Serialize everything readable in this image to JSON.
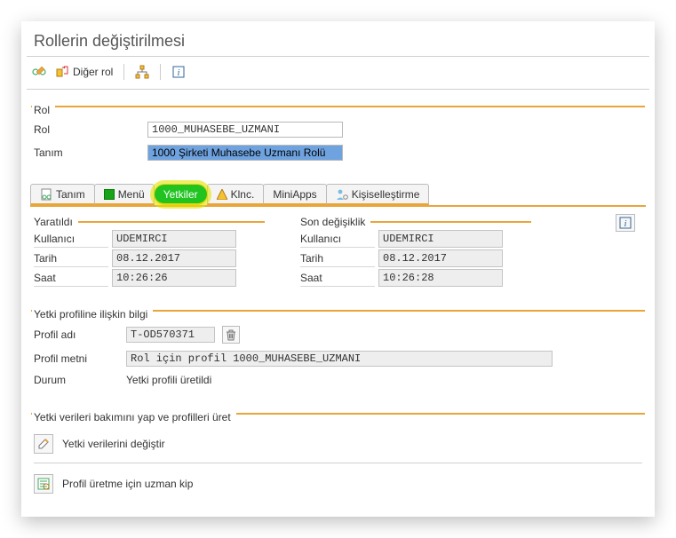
{
  "header": {
    "title": "Rollerin değiştirilmesi",
    "toolbar": {
      "other_role_label": "Diğer rol"
    }
  },
  "role_group": {
    "title": "Rol",
    "fields": {
      "role_label": "Rol",
      "role_value": "1000_MUHASEBE_UZMANI",
      "desc_label": "Tanım",
      "desc_value": "1000 Şirketi Muhasebe Uzmanı Rolü"
    }
  },
  "tabs": [
    {
      "label": "Tanım"
    },
    {
      "label": "Menü"
    },
    {
      "label": "Yetkiler"
    },
    {
      "label": "Klnc."
    },
    {
      "label": "MiniApps"
    },
    {
      "label": "Kişiselleştirme"
    }
  ],
  "created": {
    "title": "Yaratıldı",
    "user_label": "Kullanıcı",
    "user_value": "UDEMIRCI",
    "date_label": "Tarih",
    "date_value": "08.12.2017",
    "time_label": "Saat",
    "time_value": "10:26:26"
  },
  "changed": {
    "title": "Son değişiklik",
    "user_label": "Kullanıcı",
    "user_value": "UDEMIRCI",
    "date_label": "Tarih",
    "date_value": "08.12.2017",
    "time_label": "Saat",
    "time_value": "10:26:28"
  },
  "profile": {
    "title": "Yetki profiline ilişkin bilgi",
    "name_label": "Profil adı",
    "name_value": "T-OD570371",
    "text_label": "Profil metni",
    "text_value": "Rol için profil 1000_MUHASEBE_UZMANI",
    "status_label": "Durum",
    "status_value": "Yetki profili üretildi"
  },
  "maint": {
    "title": "Yetki verileri bakımını yap ve profilleri üret",
    "change_label": "Yetki verilerini değiştir",
    "expert_label": "Profil üretme için uzman kip"
  }
}
